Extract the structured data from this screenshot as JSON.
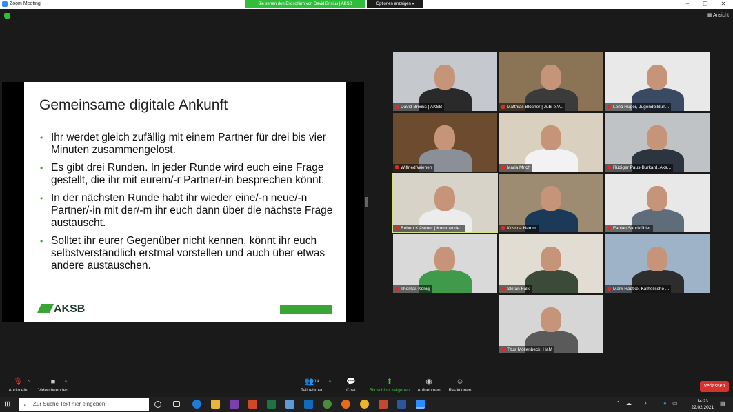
{
  "window": {
    "title": "Zoom Meeting",
    "share_banner": "Sie sehen den Bildschirm von David Brixius | AKSB",
    "share_options": "Optionen anzeigen",
    "view_label": "Ansicht",
    "controls": [
      "–",
      "❐",
      "✕"
    ]
  },
  "slide": {
    "title": "Gemeinsame digitale Ankunft",
    "bullets": [
      "Ihr werdet gleich zufällig mit einem Partner für drei bis vier Minuten zusammengelost.",
      "Es gibt drei Runden. In jeder Runde wird euch eine Frage gestellt, die ihr mit eurem/-r Partner/-in besprechen könnt.",
      "In der nächsten Runde habt ihr wieder eine/-n neue/-n Partner/-in mit der/-m ihr euch dann über die nächste Frage austauscht.",
      "Solltet ihr eurer Gegenüber nicht kennen, könnt ihr euch selbstverständlich erstmal vorstellen und auch über etwas andere austauschen."
    ],
    "logo_text": "AKSB"
  },
  "participants": [
    {
      "name": "David Brixius | AKSB"
    },
    {
      "name": "Matthias Blöcher | Jubi e.V..."
    },
    {
      "name": "Lena Rüger, Jugendbildun..."
    },
    {
      "name": "Wilfried Wienen"
    },
    {
      "name": "Maria Mrich"
    },
    {
      "name": "Rüdiger Paus-Burkard, Aka..."
    },
    {
      "name": "Robert Kläsener | Kommende..."
    },
    {
      "name": "Kristina Hamm"
    },
    {
      "name": "Fabian Sandkühler"
    },
    {
      "name": "Thomas König"
    },
    {
      "name": "Stefan Falk"
    },
    {
      "name": "Mark Radtke, Katholische ..."
    },
    {
      "name": "Titus Möllenbeck, HaM"
    }
  ],
  "toolbar": {
    "audio": "Audio ein",
    "video": "Video beenden",
    "participants": "Teilnehmer",
    "participants_count": "14",
    "chat": "Chat",
    "share": "Bildschirm freigeben",
    "record": "Aufnehmen",
    "reactions": "Reaktionen",
    "leave": "Verlassen"
  },
  "taskbar": {
    "search_placeholder": "Zur Suche Text hier eingeben",
    "time": "14:23",
    "date": "22.02.2021"
  }
}
